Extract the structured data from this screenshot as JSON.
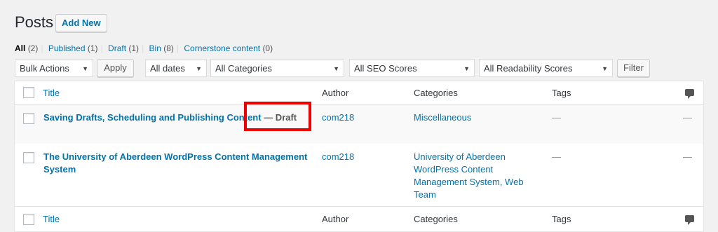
{
  "header": {
    "title": "Posts",
    "add_new": "Add New"
  },
  "filters": {
    "all": "All",
    "all_count": "(2)",
    "published": "Published",
    "published_count": "(1)",
    "draft": "Draft",
    "draft_count": "(1)",
    "bin": "Bin",
    "bin_count": "(8)",
    "cornerstone": "Cornerstone content",
    "cornerstone_count": "(0)",
    "separator": "|"
  },
  "toolbar": {
    "bulk_actions": "Bulk Actions",
    "apply": "Apply",
    "dates": "All dates",
    "categories": "All Categories",
    "seo": "All SEO Scores",
    "readability": "All Readability Scores",
    "filter": "Filter"
  },
  "table": {
    "columns": {
      "title": "Title",
      "author": "Author",
      "categories": "Categories",
      "tags": "Tags"
    },
    "rows": [
      {
        "title": "Saving Drafts, Scheduling and Publishing Content",
        "state": " — Draft",
        "author": "com218",
        "categories_lines": [
          "Miscellaneous"
        ],
        "tags": "—",
        "comments": "—"
      },
      {
        "title_lines": [
          "The University of Aberdeen WordPress Content Management",
          "System"
        ],
        "author": "com218",
        "categories_lines": [
          "University of Aberdeen",
          "WordPress Content",
          "Management System, Web",
          "Team"
        ],
        "tags": "—",
        "comments": "—"
      }
    ]
  },
  "colors": {
    "link": "#0073aa",
    "highlight": "#ee0000"
  }
}
